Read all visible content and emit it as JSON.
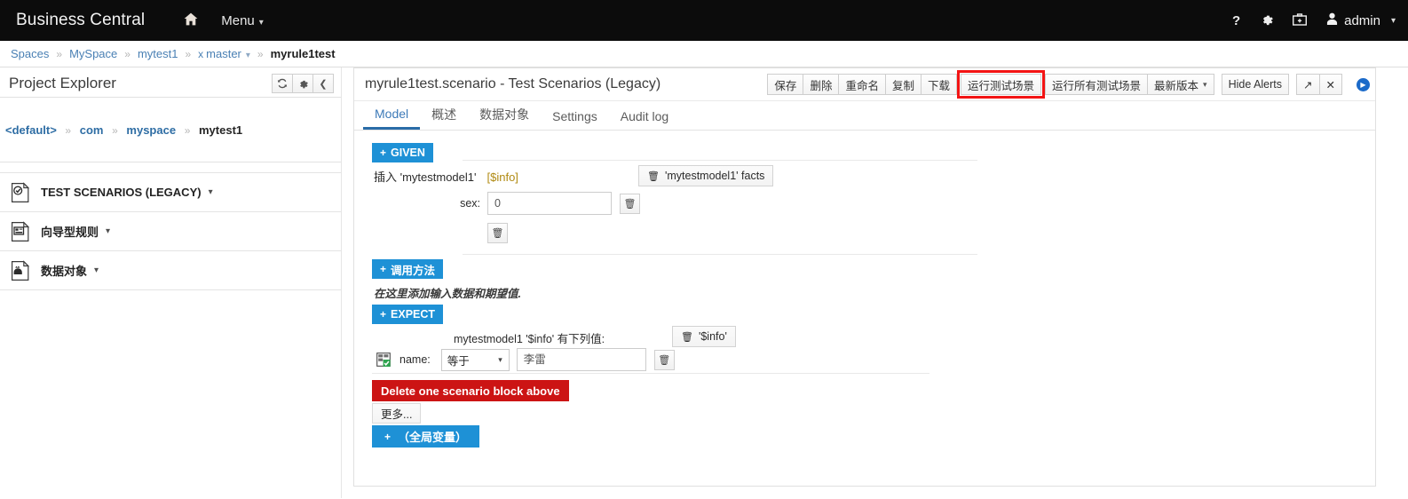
{
  "navbar": {
    "brand": "Business Central",
    "home_icon": "home-icon",
    "menu_label": "Menu",
    "help_icon": "question-mark-icon",
    "settings_icon": "gear-icon",
    "apps_icon": "briefcase-icon",
    "user_icon": "user-icon",
    "user_label": "admin"
  },
  "breadcrumb": {
    "items": [
      {
        "label": "Spaces",
        "type": "link"
      },
      {
        "label": "MySpace",
        "type": "link"
      },
      {
        "label": "mytest1",
        "type": "link"
      },
      {
        "label": "master",
        "type": "branch"
      },
      {
        "label": "myrule1test",
        "type": "current"
      }
    ],
    "separator": "»",
    "branch_icon": "git-branch-icon"
  },
  "project_explorer": {
    "title": "Project Explorer",
    "refresh_icon": "refresh-icon",
    "gear_icon": "gear-icon",
    "collapse_icon": "chevron-left-icon",
    "path": [
      {
        "label": "<default>",
        "type": "link"
      },
      {
        "label": "com",
        "type": "link"
      },
      {
        "label": "myspace",
        "type": "link"
      },
      {
        "label": "mytest1",
        "type": "current"
      }
    ],
    "separator": "»",
    "accordion": [
      {
        "label": "TEST SCENARIOS (LEGACY)",
        "icon": "test-scenario-file-icon"
      },
      {
        "label": "向导型规则",
        "icon": "guided-rule-file-icon"
      },
      {
        "label": "数据对象",
        "icon": "data-object-file-icon"
      }
    ],
    "caret": "▾"
  },
  "editor": {
    "title": "myrule1test.scenario - Test Scenarios (Legacy)",
    "toolbar": {
      "save": "保存",
      "delete": "删除",
      "rename": "重命名",
      "copy": "复制",
      "download": "下载",
      "run_test_scenario": "运行测试场景",
      "run_all_test_scenarios": "运行所有测试场景",
      "latest_version": "最新版本",
      "hide_alerts": "Hide Alerts",
      "maximize_icon": "expand-icon",
      "close_icon": "close-icon",
      "play_icon": "play-icon",
      "highlight_color": "#f31414"
    },
    "tabs": [
      {
        "label": "Model",
        "active": true
      },
      {
        "label": "概述",
        "active": false
      },
      {
        "label": "数据对象",
        "active": false
      },
      {
        "label": "Settings",
        "active": false
      },
      {
        "label": "Audit log",
        "active": false
      }
    ]
  },
  "scenario": {
    "given_button": "GIVEN",
    "plus": "+",
    "insert_text": "插入 'mytestmodel1'",
    "insert_binding": "[$info]",
    "facts_button": "'mytestmodel1' facts",
    "trash_icon": "trash-icon",
    "field": {
      "label": "sex:",
      "value": "0"
    },
    "call_method_button": "调用方法",
    "hint": "在这里添加输入数据和期望值.",
    "expect_button": "EXPECT",
    "expect_header": "mytestmodel1 '$info' 有下列值:",
    "expect_fact_button": "'$info'",
    "expect_row": {
      "icon": "grid-green-icon",
      "label": "name:",
      "operator": "等于",
      "value": "李雷"
    },
    "delete_block_button": "Delete one scenario block above",
    "more_button": "更多...",
    "global_var_button": "（全局变量）"
  }
}
